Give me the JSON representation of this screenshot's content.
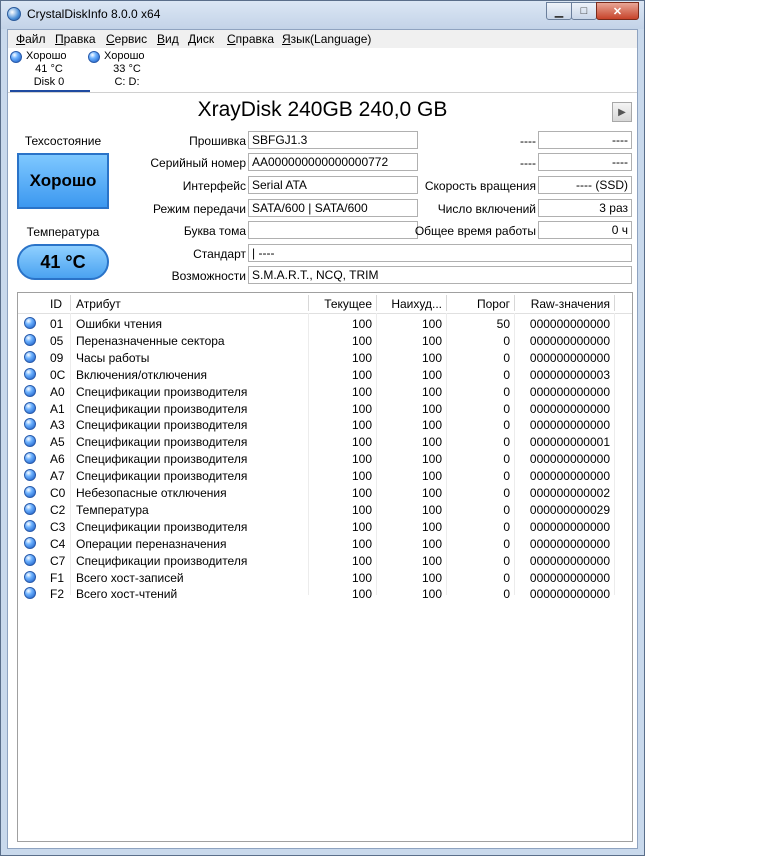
{
  "window": {
    "title": "CrystalDiskInfo 8.0.0 x64",
    "close_glyph": "✕",
    "min_glyph": "▁",
    "max_glyph": "□"
  },
  "menu": [
    {
      "hotkey": "Ф",
      "rest": "айл"
    },
    {
      "hotkey": "П",
      "rest": "равка"
    },
    {
      "hotkey": "С",
      "rest": "ервис"
    },
    {
      "hotkey": "В",
      "rest": "ид"
    },
    {
      "hotkey": "Д",
      "rest": "иск"
    },
    {
      "hotkey": "С",
      "rest": "правка"
    },
    {
      "hotkey": "Я",
      "rest": "зык(Language)"
    }
  ],
  "disks": [
    {
      "status": "Хорошо",
      "temp": "41 °C",
      "name": "Disk 0"
    },
    {
      "status": "Хорошо",
      "temp": "33 °C",
      "name": "C: D:"
    }
  ],
  "model": "XrayDisk 240GB 240,0 GB",
  "health_label": "Техсостояние",
  "health_value": "Хорошо",
  "temp_label": "Температура",
  "temp_value": "41 °C",
  "info": {
    "firmware_label": "Прошивка",
    "firmware": "SBFGJ1.3",
    "serial_label": "Серийный номер",
    "serial": "AA000000000000000772",
    "interface_label": "Интерфейс",
    "interface": "Serial ATA",
    "transfer_label": "Режим передачи",
    "transfer": "SATA/600 | SATA/600",
    "drive_letter_label": "Буква тома",
    "drive_letter": "",
    "standard_label": "Стандарт",
    "standard": "| ----",
    "features_label": "Возможности",
    "features": "S.M.A.R.T., NCQ, TRIM",
    "right1_label": "----",
    "right1": "----",
    "right2_label": "----",
    "right2": "----",
    "rotation_label": "Скорость вращения",
    "rotation": "---- (SSD)",
    "power_count_label": "Число включений",
    "power_count": "3 раз",
    "power_hours_label": "Общее время работы",
    "power_hours": "0 ч"
  },
  "table": {
    "headers": {
      "id": "ID",
      "attr": "Атрибут",
      "current": "Текущее",
      "worst": "Наихуд...",
      "threshold": "Порог",
      "raw": "Raw-значения"
    },
    "rows": [
      {
        "id": "01",
        "attr": "Ошибки чтения",
        "current": "100",
        "worst": "100",
        "threshold": "50",
        "raw": "000000000000"
      },
      {
        "id": "05",
        "attr": "Переназначенные сектора",
        "current": "100",
        "worst": "100",
        "threshold": "0",
        "raw": "000000000000"
      },
      {
        "id": "09",
        "attr": "Часы работы",
        "current": "100",
        "worst": "100",
        "threshold": "0",
        "raw": "000000000000"
      },
      {
        "id": "0C",
        "attr": "Включения/отключения",
        "current": "100",
        "worst": "100",
        "threshold": "0",
        "raw": "000000000003"
      },
      {
        "id": "A0",
        "attr": "Спецификации производителя",
        "current": "100",
        "worst": "100",
        "threshold": "0",
        "raw": "000000000000"
      },
      {
        "id": "A1",
        "attr": "Спецификации производителя",
        "current": "100",
        "worst": "100",
        "threshold": "0",
        "raw": "000000000000"
      },
      {
        "id": "A3",
        "attr": "Спецификации производителя",
        "current": "100",
        "worst": "100",
        "threshold": "0",
        "raw": "000000000000"
      },
      {
        "id": "A5",
        "attr": "Спецификации производителя",
        "current": "100",
        "worst": "100",
        "threshold": "0",
        "raw": "000000000001"
      },
      {
        "id": "A6",
        "attr": "Спецификации производителя",
        "current": "100",
        "worst": "100",
        "threshold": "0",
        "raw": "000000000000"
      },
      {
        "id": "A7",
        "attr": "Спецификации производителя",
        "current": "100",
        "worst": "100",
        "threshold": "0",
        "raw": "000000000000"
      },
      {
        "id": "C0",
        "attr": "Небезопасные отключения",
        "current": "100",
        "worst": "100",
        "threshold": "0",
        "raw": "000000000002"
      },
      {
        "id": "C2",
        "attr": "Температура",
        "current": "100",
        "worst": "100",
        "threshold": "0",
        "raw": "000000000029"
      },
      {
        "id": "C3",
        "attr": "Спецификации производителя",
        "current": "100",
        "worst": "100",
        "threshold": "0",
        "raw": "000000000000"
      },
      {
        "id": "C4",
        "attr": "Операции переназначения",
        "current": "100",
        "worst": "100",
        "threshold": "0",
        "raw": "000000000000"
      },
      {
        "id": "C7",
        "attr": "Спецификации производителя",
        "current": "100",
        "worst": "100",
        "threshold": "0",
        "raw": "000000000000"
      },
      {
        "id": "F1",
        "attr": "Всего хост-записей",
        "current": "100",
        "worst": "100",
        "threshold": "0",
        "raw": "000000000000"
      },
      {
        "id": "F2",
        "attr": "Всего хост-чтений",
        "current": "100",
        "worst": "100",
        "threshold": "0",
        "raw": "000000000000"
      }
    ]
  },
  "colors": {
    "good_status": "#3c98f0",
    "window_frame": "#c9d9ec"
  }
}
